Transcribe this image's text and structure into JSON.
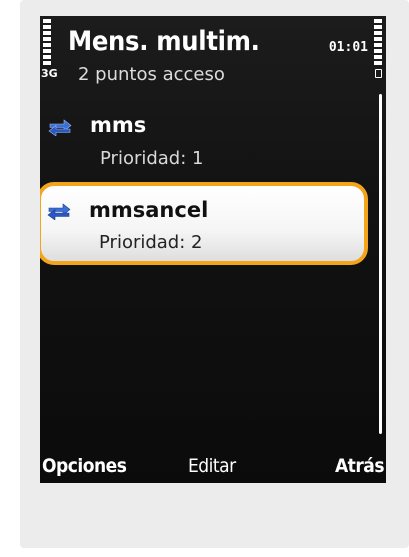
{
  "header": {
    "title": "Mens. multim.",
    "clock": "01:01",
    "network": "3G",
    "subtitle": "2 puntos acceso"
  },
  "list": {
    "items": [
      {
        "name": "mms",
        "priority": "Prioridad: 1",
        "icon": "transfer-arrows-icon",
        "selected": false
      },
      {
        "name": "mmsancel",
        "priority": "Prioridad: 2",
        "icon": "transfer-arrows-icon",
        "selected": true
      }
    ]
  },
  "softkeys": {
    "left": "Opciones",
    "middle": "Editar",
    "right": "Atrás"
  },
  "colors": {
    "highlight_border": "#f3a41a",
    "icon_blue": "#3a6fd8",
    "background": "#111111"
  }
}
